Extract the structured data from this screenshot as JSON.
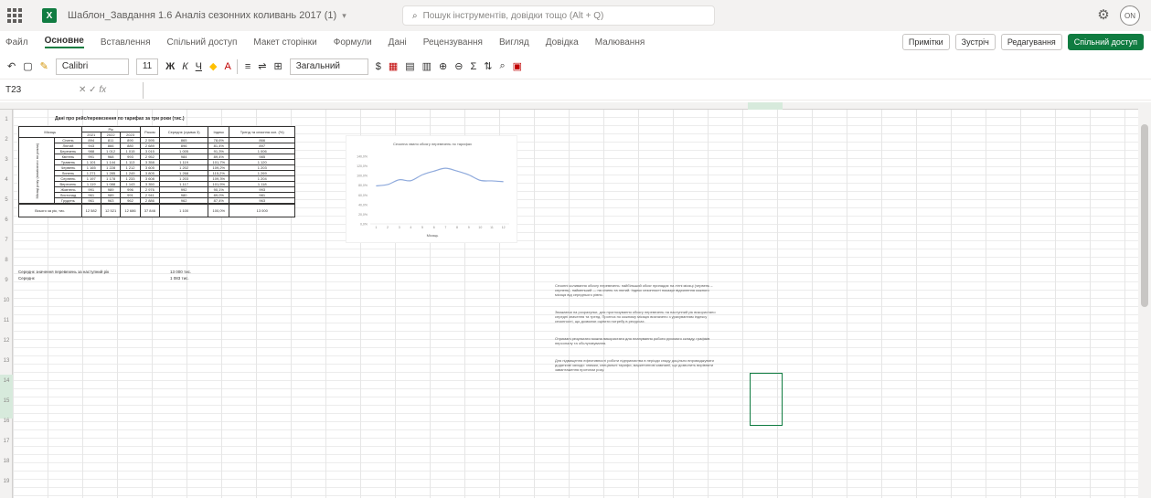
{
  "titlebar": {
    "doc_title": "Шаблон_Завдання 1.6 Аналіз сезонних коливань 2017 (1)",
    "search_placeholder": "Пошук інструментів, довідки тощо (Alt + Q)",
    "user_initials": "ON"
  },
  "menu": {
    "tabs": [
      "Файл",
      "Основне",
      "Вставлення",
      "Спільний доступ",
      "Макет сторінки",
      "Формули",
      "Дані",
      "Рецензування",
      "Вигляд",
      "Довідка",
      "Малювання"
    ],
    "active": "Основне",
    "actions": [
      "Примітки",
      "Зустріч",
      "Редагування",
      "Спільний доступ"
    ]
  },
  "ribbon": {
    "font": "Calibri",
    "size": "11",
    "format": "Загальний",
    "currency": "$",
    "sum_symbol": "Σ"
  },
  "formula_bar": {
    "cell_ref": "T23",
    "fx": "fx"
  },
  "table": {
    "title": "Дані про рейс/перевезення по тарифах за три роки (тис.)",
    "headers": [
      "Місяць",
      "Рік",
      "2021",
      "2022",
      "2023",
      "Разом",
      "Середнє (сумма 3)",
      "Індекс",
      "Тренд та сезонна скл. (%)"
    ],
    "side_label": "Місяці року (помісячно по роках)",
    "rows": [
      [
        "Січень",
        "894",
        "811",
        "890",
        "2 595",
        "865",
        "78,6%",
        "866"
      ],
      [
        "Лютий",
        "943",
        "866",
        "880",
        "2 689",
        "896",
        "81,4%",
        "897"
      ],
      [
        "Березень",
        "988",
        "1 012",
        "1 015",
        "3 015",
        "1 005",
        "91,3%",
        "1 006"
      ],
      [
        "Квітень",
        "991",
        "968",
        "993",
        "2 952",
        "984",
        "89,4%",
        "985"
      ],
      [
        "Травень",
        "1 101",
        "1 144",
        "1 113",
        "3 358",
        "1 119",
        "101,7%",
        "1 120"
      ],
      [
        "Червень",
        "1 165",
        "1 228",
        "1 212",
        "3 605",
        "1 202",
        "109,2%",
        "1 203"
      ],
      [
        "Липень",
        "1 271",
        "1 285",
        "1 249",
        "3 805",
        "1 268",
        "115,2%",
        "1 269"
      ],
      [
        "Серпень",
        "1 197",
        "1 178",
        "1 233",
        "3 608",
        "1 203",
        "109,3%",
        "1 204"
      ],
      [
        "Вересень",
        "1 119",
        "1 088",
        "1 143",
        "3 350",
        "1 117",
        "101,5%",
        "1 118"
      ],
      [
        "Жовтень",
        "991",
        "989",
        "996",
        "2 976",
        "992",
        "90,1%",
        "993"
      ],
      [
        "Листопад",
        "961",
        "989",
        "991",
        "2 941",
        "980",
        "89,0%",
        "981"
      ],
      [
        "Грудень",
        "961",
        "963",
        "962",
        "2 886",
        "962",
        "87,4%",
        "963"
      ]
    ],
    "total_row": [
      "Всього за рік, тис.",
      "12 582",
      "12 521",
      "12 686",
      "37 846",
      "1 100",
      "100,0%",
      "13 000"
    ]
  },
  "notes": [
    {
      "label": "Середнє значення перевезень за наступний рік",
      "value": "13 000 тис."
    },
    {
      "label": "Середнє",
      "value": "1 083 тис."
    }
  ],
  "chart_data": {
    "type": "line",
    "title": "Сезонна хвиля обсягу перевезень по тарифах",
    "xlabel": "Місяць",
    "categories": [
      "1",
      "2",
      "3",
      "4",
      "5",
      "6",
      "7",
      "8",
      "9",
      "10",
      "11",
      "12"
    ],
    "values": [
      78.6,
      81.4,
      91.3,
      89.4,
      101.7,
      109.2,
      115.2,
      109.3,
      101.5,
      90.1,
      89.0,
      87.4
    ],
    "ylim": [
      0,
      140
    ],
    "yticks": [
      "140,0%",
      "120,0%",
      "100,0%",
      "80,0%",
      "60,0%",
      "40,0%",
      "20,0%",
      "0,0%"
    ],
    "line_color": "#8faadc"
  },
  "textblock": [
    "Сезонні коливання обсягу перевезень: найбільший обсяг припадає на літні місяці (червень – серпень), найменший — на січень та лютий. Індекс сезонності показує відхилення кожного місяця від середнього рівня.",
    "Зважаючи на розрахунки, для прогнозування обсягу перевезень на наступний рік використано середні значення та тренд. Прогноз по кожному місяцю визначено з урахуванням індексу сезонності, що дозволяє оцінити потребу в ресурсах.",
    "Отримані результати можна використати для планування роботи рухомого складу, графіків персоналу та обслуговування.",
    "Для підвищення ефективності роботи підприємства в періоди спаду доцільно впроваджувати додаткові заходи: знижки, спеціальні тарифи, маркетингові кампанії, що дозволить вирівняти завантаження протягом року."
  ],
  "row_numbers": [
    "1",
    "2",
    "3",
    "4",
    "5",
    "6",
    "7",
    "8",
    "9",
    "10",
    "11",
    "12",
    "13",
    "14",
    "15",
    "16",
    "17",
    "18",
    "19"
  ]
}
